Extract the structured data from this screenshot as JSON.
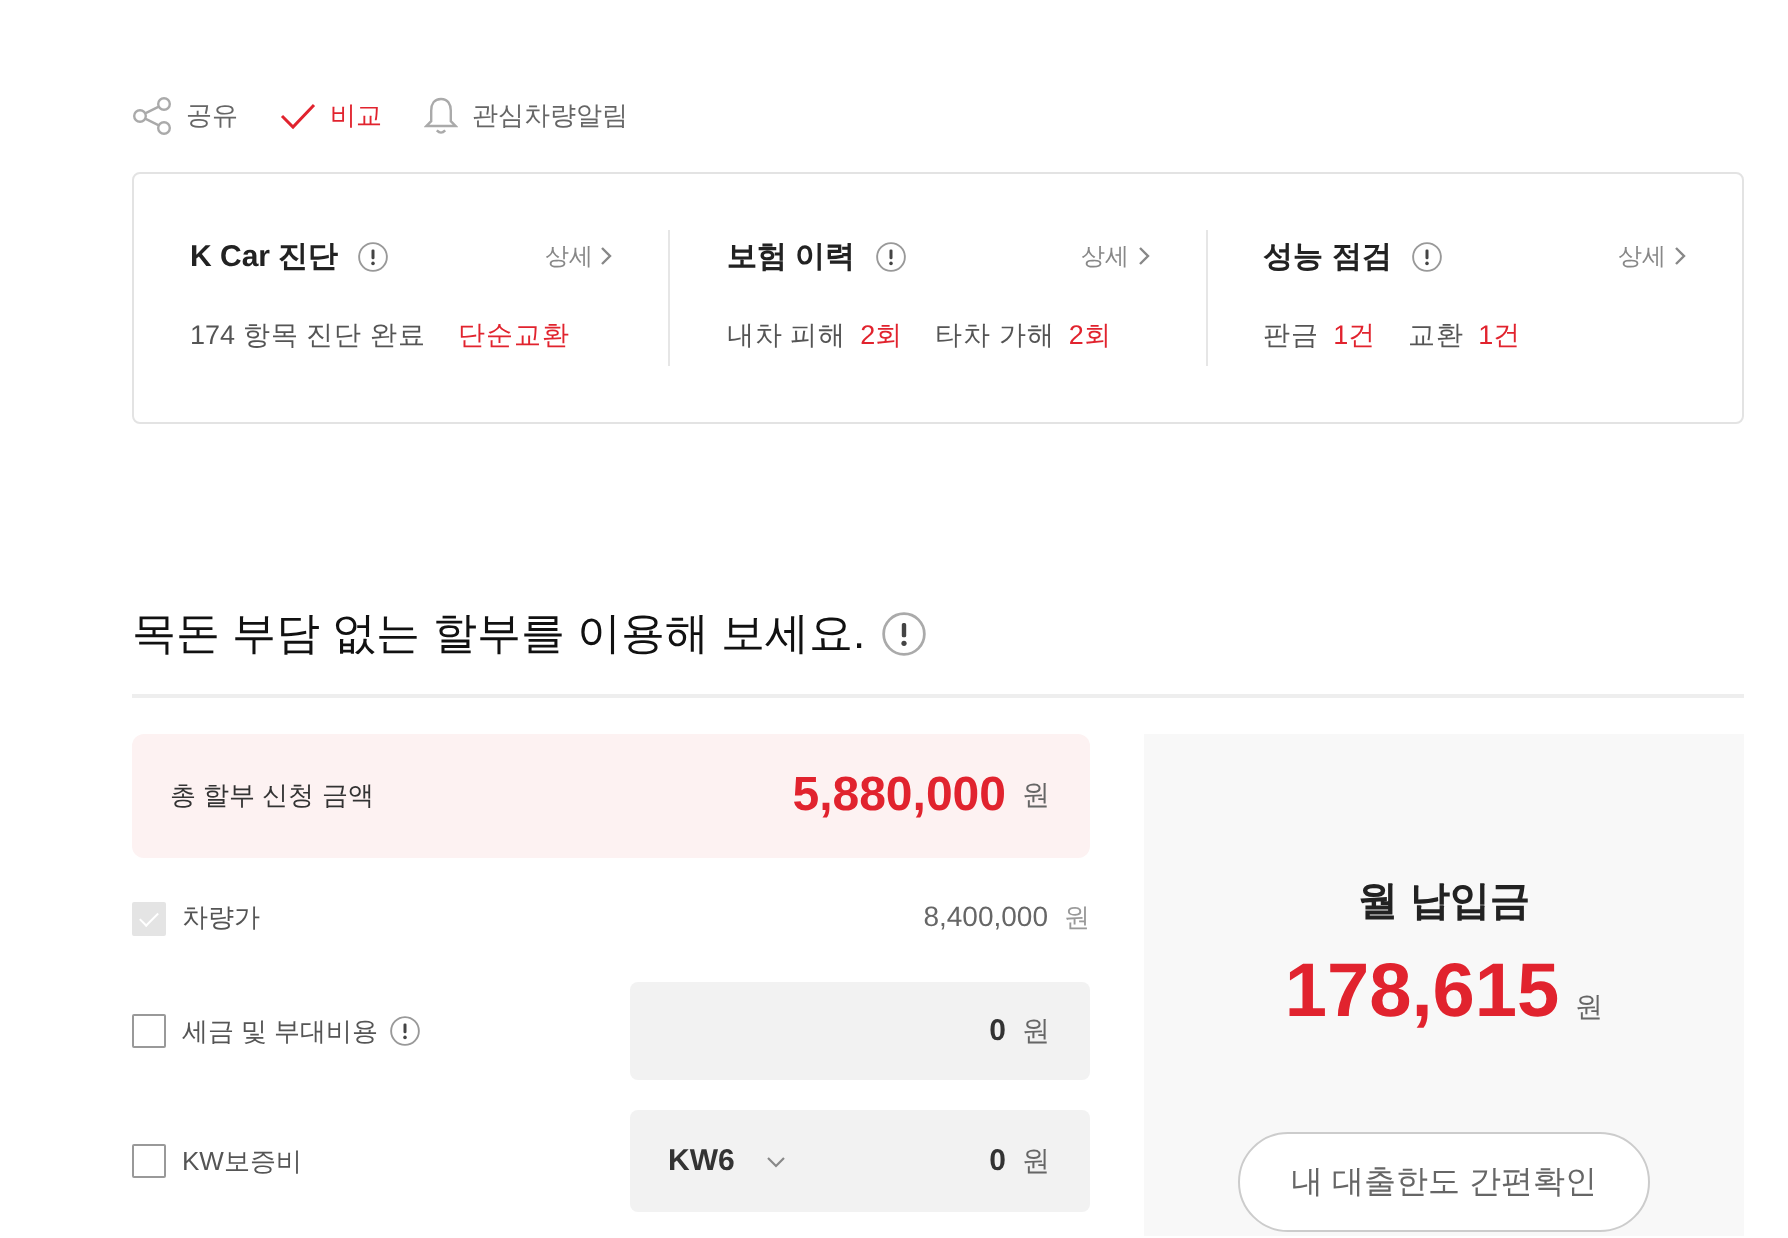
{
  "actions": [
    {
      "kind": "share",
      "label": "공유",
      "on": false
    },
    {
      "kind": "compare",
      "label": "비교",
      "on": true
    },
    {
      "kind": "alert",
      "label": "관심차량알림",
      "on": false
    }
  ],
  "summary": [
    {
      "title": "K Car 진단",
      "link": "상세",
      "facts": [
        {
          "label": "174 항목 진단 완료"
        },
        {
          "value": "단순교환"
        }
      ]
    },
    {
      "title": "보험 이력",
      "link": "상세",
      "facts": [
        {
          "label": "내차 피해",
          "value": "2회"
        },
        {
          "label": "타차 가해",
          "value": "2회"
        }
      ]
    },
    {
      "title": "성능 점검",
      "link": "상세",
      "facts": [
        {
          "label": "판금",
          "value": "1건"
        },
        {
          "label": "교환",
          "value": "1건"
        }
      ]
    }
  ],
  "installment": {
    "title": "목돈 부담 없는 할부를 이용해 보세요.",
    "total": {
      "label": "총 할부 신청 금액",
      "amount": "5,880,000",
      "unit": "원"
    },
    "items": [
      {
        "kind": "plain",
        "label": "차량가",
        "checked": true,
        "disabled": true,
        "info": false,
        "amount": "8,400,000",
        "unit": "원"
      },
      {
        "kind": "field",
        "label": "세금 및 부대비용",
        "checked": false,
        "disabled": false,
        "info": true,
        "amount": "0",
        "unit": "원"
      },
      {
        "kind": "select",
        "label": "KW보증비",
        "checked": false,
        "disabled": false,
        "info": false,
        "option": "KW6",
        "amount": "0",
        "unit": "원"
      }
    ]
  },
  "monthly_payment": {
    "title": "월 납입금",
    "amount": "178,615",
    "unit": "원",
    "button": "내 대출한도 간편확인"
  }
}
